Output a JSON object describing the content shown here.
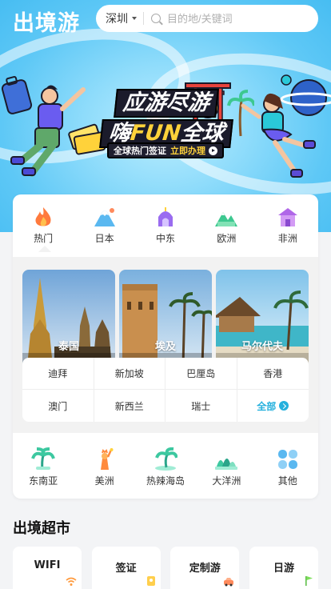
{
  "header": {
    "logo": "出境游",
    "city": "深圳",
    "search_placeholder": "目的地/关键词"
  },
  "banner": {
    "title_line1": "应游尽游",
    "title_line2_a": "嗨",
    "title_line2_b": "FUN",
    "title_line2_c": "全球",
    "subtitle": "全球热门签证",
    "cta": "立即办理"
  },
  "tabs": [
    {
      "label": "热门",
      "icon": "flame-icon",
      "color": "#ff7a3d"
    },
    {
      "label": "日本",
      "icon": "mount-fuji-icon",
      "color": "#5ab8f0"
    },
    {
      "label": "中东",
      "icon": "mosque-icon",
      "color": "#9a6cf0"
    },
    {
      "label": "欧洲",
      "icon": "alps-icon",
      "color": "#3dc890"
    },
    {
      "label": "非洲",
      "icon": "hut-icon",
      "color": "#b067e8"
    }
  ],
  "destinations": [
    {
      "name": "泰国"
    },
    {
      "name": "埃及"
    },
    {
      "name": "马尔代夫"
    }
  ],
  "cities": [
    "迪拜",
    "新加坡",
    "巴厘岛",
    "香港",
    "澳门",
    "新西兰",
    "瑞士"
  ],
  "all_label": "全部",
  "regions": [
    {
      "label": "东南亚",
      "icon": "palm-icon"
    },
    {
      "label": "美洲",
      "icon": "liberty-icon"
    },
    {
      "label": "热辣海岛",
      "icon": "island-icon"
    },
    {
      "label": "大洋洲",
      "icon": "opera-house-icon"
    },
    {
      "label": "其他",
      "icon": "grid-icon"
    }
  ],
  "market": {
    "title": "出境超市",
    "items": [
      {
        "label": "WIFI",
        "icon": "wifi-icon"
      },
      {
        "label": "签证",
        "icon": "passport-icon"
      },
      {
        "label": "定制游",
        "icon": "car-icon"
      },
      {
        "label": "日游",
        "icon": "flag-icon"
      }
    ]
  }
}
